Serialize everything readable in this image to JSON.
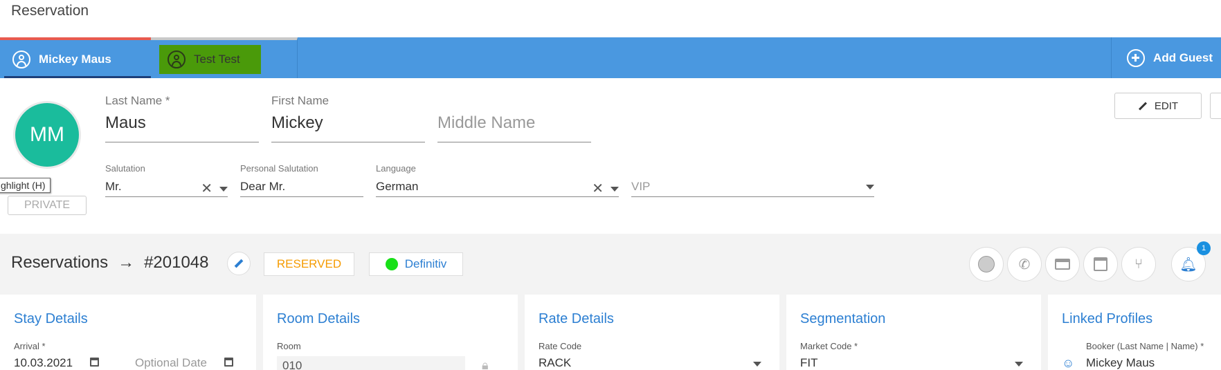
{
  "header": {
    "title": "Reservation"
  },
  "guest_tabs": [
    {
      "label": "Mickey Maus"
    },
    {
      "label": "Test Test"
    }
  ],
  "add_guest_label": "Add Guest",
  "profile": {
    "initials": "MM",
    "tooltip": "ghlight (H)",
    "private_label": "PRIVATE",
    "last_name": {
      "label": "Last Name *",
      "value": "Maus"
    },
    "first_name": {
      "label": "First Name",
      "value": "Mickey"
    },
    "middle_name": {
      "placeholder": "Middle Name"
    },
    "salutation": {
      "label": "Salutation",
      "value": "Mr."
    },
    "personal_salutation": {
      "label": "Personal Salutation",
      "value": "Dear Mr."
    },
    "language": {
      "label": "Language",
      "value": "German"
    },
    "vip": {
      "placeholder": "VIP"
    },
    "edit_label": "EDIT"
  },
  "reservation": {
    "title": "Reservations",
    "arrow": "→",
    "number": "#201048",
    "status": "RESERVED",
    "type": "Definitiv",
    "type_color": "#18e018",
    "notification_count": "1"
  },
  "cards": {
    "stay": {
      "title": "Stay Details",
      "label": "Arrival *",
      "value": "10.03.2021",
      "optional_placeholder": "Optional Date"
    },
    "room": {
      "title": "Room Details",
      "label": "Room",
      "value": "010"
    },
    "rate": {
      "title": "Rate Details",
      "label": "Rate Code",
      "value": "RACK"
    },
    "segmentation": {
      "title": "Segmentation",
      "label": "Market Code *",
      "value": "FIT"
    },
    "linked": {
      "title": "Linked Profiles",
      "label": "Booker (Last Name | Name) *",
      "value": "Mickey Maus"
    }
  },
  "colors": {
    "accent": "#4a98e0",
    "avatar": "#1abc9c",
    "reserved": "#f59b00"
  },
  "icons": [
    "user-circle-icon",
    "add-circle-icon",
    "edit-pencil-icon",
    "clear-icon",
    "dropdown-caret-icon",
    "status-circle-icon",
    "phone-icon",
    "credit-card-icon",
    "calendar-icon",
    "split-icon",
    "bell-icon"
  ]
}
